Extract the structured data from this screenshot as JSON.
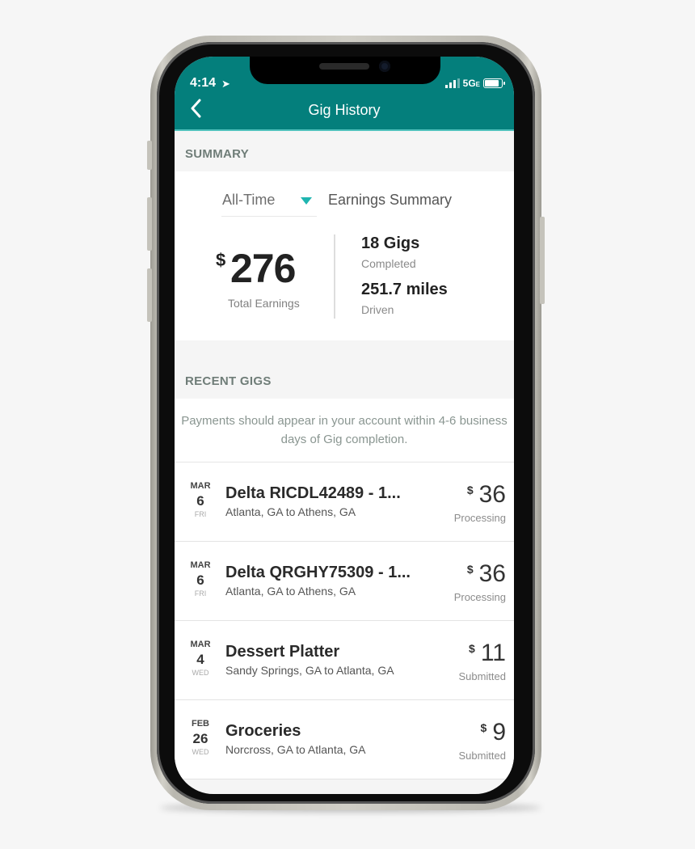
{
  "status_bar": {
    "time": "4:14",
    "network": "5G",
    "network_suffix": "E"
  },
  "header": {
    "title": "Gig History"
  },
  "summary": {
    "section_label": "SUMMARY",
    "period_selected": "All-Time",
    "period_suffix": "Earnings Summary",
    "currency": "$",
    "total_earnings": "276",
    "total_label": "Total Earnings",
    "gigs_value": "18 Gigs",
    "gigs_label": "Completed",
    "miles_value": "251.7 miles",
    "miles_label": "Driven"
  },
  "recent": {
    "section_label": "RECENT GIGS",
    "notice": "Payments should appear in your account within 4-6 business days of Gig completion.",
    "gigs": [
      {
        "month": "MAR",
        "day": "6",
        "weekday": "FRI",
        "title": "Delta RICDL42489 - 1...",
        "route": "Atlanta, GA to Athens, GA",
        "currency": "$",
        "amount": "36",
        "status": "Processing"
      },
      {
        "month": "MAR",
        "day": "6",
        "weekday": "FRI",
        "title": "Delta QRGHY75309 - 1...",
        "route": "Atlanta, GA to Athens, GA",
        "currency": "$",
        "amount": "36",
        "status": "Processing"
      },
      {
        "month": "MAR",
        "day": "4",
        "weekday": "WED",
        "title": "Dessert Platter",
        "route": "Sandy Springs, GA to Atlanta, GA",
        "currency": "$",
        "amount": "11",
        "status": "Submitted"
      },
      {
        "month": "FEB",
        "day": "26",
        "weekday": "WED",
        "title": "Groceries",
        "route": "Norcross, GA to Atlanta, GA",
        "currency": "$",
        "amount": "9",
        "status": "Submitted"
      }
    ]
  },
  "colors": {
    "brand_teal": "#047f7c",
    "accent_caret": "#1fb5b0"
  }
}
